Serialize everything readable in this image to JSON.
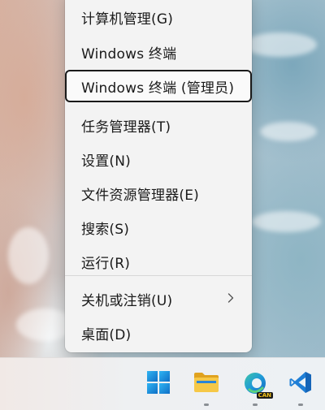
{
  "menu": {
    "items": [
      {
        "label": "计算机管理(G)"
      },
      {
        "label": "Windows 终端"
      },
      {
        "label": "Windows 终端 (管理员)"
      },
      {
        "label": "任务管理器(T)"
      },
      {
        "label": "设置(N)"
      },
      {
        "label": "文件资源管理器(E)"
      },
      {
        "label": "搜索(S)"
      },
      {
        "label": "运行(R)"
      },
      {
        "label": "关机或注销(U)",
        "submenu_icon": "chevron-right-icon"
      },
      {
        "label": "桌面(D)"
      }
    ],
    "focused_item": "Windows 终端 (管理员)"
  },
  "taskbar": {
    "apps": [
      {
        "name": "start-button",
        "icon": "windows-logo-icon"
      },
      {
        "name": "file-explorer",
        "icon": "folder-icon"
      },
      {
        "name": "edge-canary",
        "icon": "edge-icon",
        "badge": "CAN"
      },
      {
        "name": "vscode",
        "icon": "vscode-icon"
      }
    ]
  },
  "colors": {
    "menu_bg": "#f3f3f3",
    "focus_border": "#1a1a1a",
    "windows_blue": "#1a8fe3",
    "folder_yellow": "#f4c13a",
    "vscode_blue": "#1f7fd6"
  }
}
